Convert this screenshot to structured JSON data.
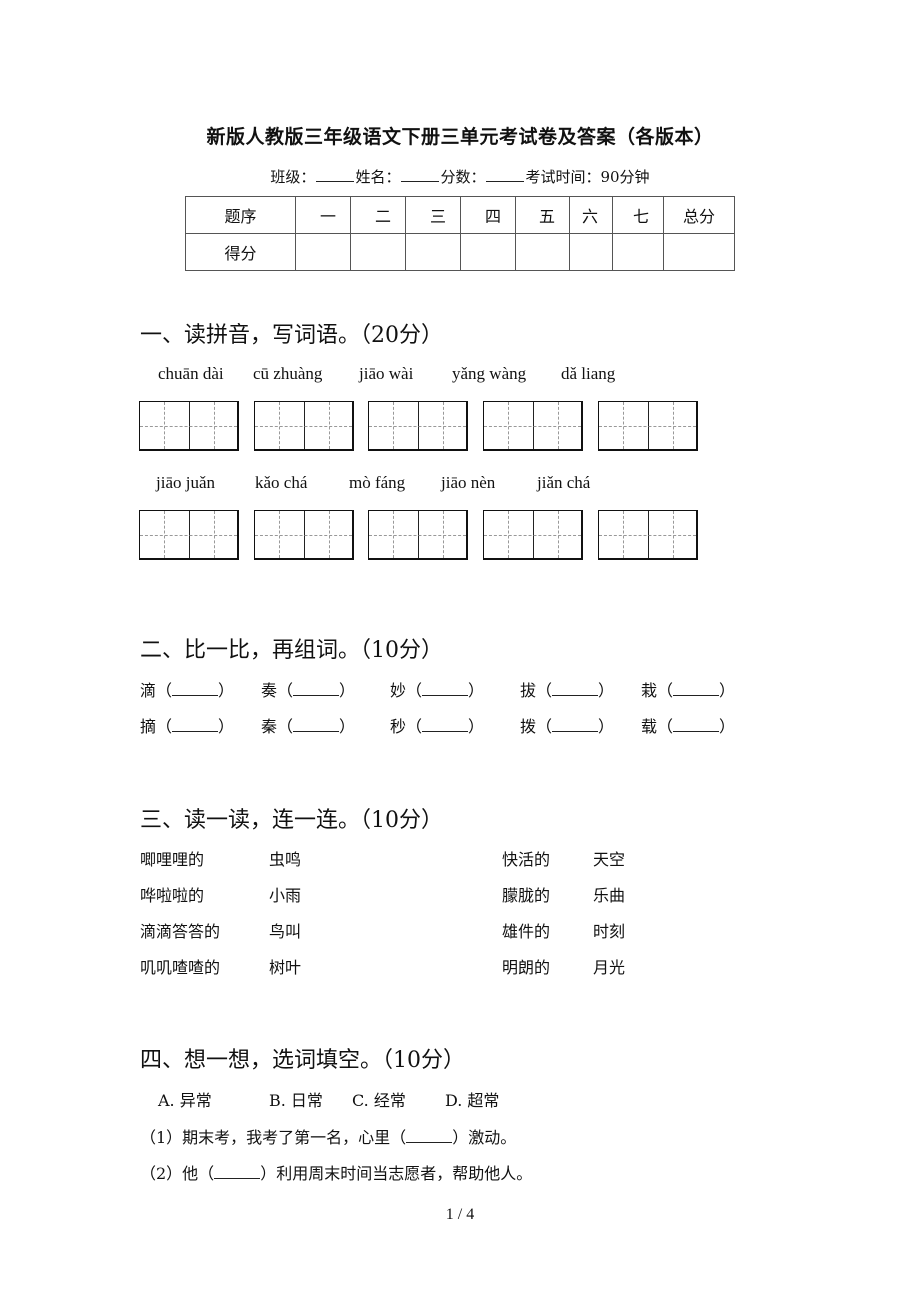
{
  "header": {
    "title": "新版人教版三年级语文下册三单元考试卷及答案（各版本）",
    "info": {
      "class_label": "班级：",
      "name_label": "姓名：",
      "score_label": "分数：",
      "time_label": "考试时间：90分钟"
    }
  },
  "score_table": {
    "row1": [
      "题序",
      "一",
      "二",
      "三",
      "四",
      "五",
      "六",
      "七",
      "总分"
    ],
    "row2": [
      "得分",
      "",
      "",
      "",
      "",
      "",
      "",
      "",
      ""
    ]
  },
  "section1": {
    "title": "一、读拼音，写词语。（20分）",
    "row1": [
      "chuān dài",
      "cū zhuàng",
      "jiāo wài",
      "yǎng wàng",
      "dǎ liang"
    ],
    "row2": [
      "jiāo juǎn",
      "kǎo chá",
      "mò fáng",
      "jiāo nèn",
      "jiǎn chá"
    ]
  },
  "section2": {
    "title": "二、比一比，再组词。（10分）",
    "row1": [
      "滴",
      "奏",
      "妙",
      "拔",
      "栽"
    ],
    "row2": [
      "摘",
      "秦",
      "秒",
      "拨",
      "载"
    ],
    "paren_open": "（",
    "paren_close": "）"
  },
  "section3": {
    "title": "三、读一读，连一连。（10分）",
    "left_a": [
      "唧哩哩的",
      "哗啦啦的",
      "滴滴答答的",
      "叽叽喳喳的"
    ],
    "left_b": [
      "虫鸣",
      "小雨",
      "鸟叫",
      "树叶"
    ],
    "right_a": [
      "快活的",
      "朦胧的",
      "雄件的",
      "明朗的"
    ],
    "right_b": [
      "天空",
      "乐曲",
      "时刻",
      "月光"
    ]
  },
  "section4": {
    "title": "四、想一想，选词填空。（10分）",
    "options": [
      "A. 异常",
      "B. 日常",
      "C. 经常",
      "D.  超常"
    ],
    "q1_before": "（1）期末考，我考了第一名，心里（",
    "q1_after": "）激动。",
    "q2_before": "（2）他（",
    "q2_after": "）利用周末时间当志愿者，帮助他人。"
  },
  "footer": {
    "page": "1 / 4"
  }
}
